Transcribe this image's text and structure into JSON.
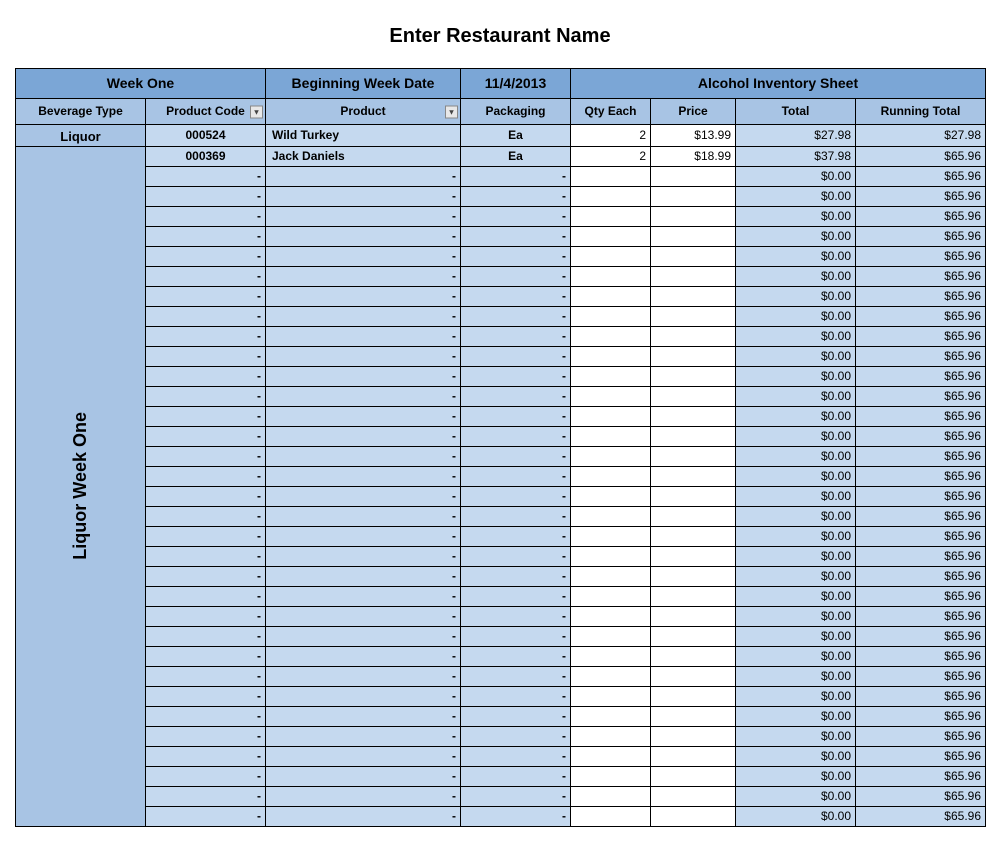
{
  "title": "Enter Restaurant Name",
  "header": {
    "week_label": "Week One",
    "begin_label": "Beginning Week Date",
    "begin_date": "11/4/2013",
    "sheet_label": "Alcohol Inventory Sheet"
  },
  "columns": {
    "bev_type": "Beverage Type",
    "code": "Product Code",
    "product": "Product",
    "packaging": "Packaging",
    "qty": "Qty Each",
    "price": "Price",
    "total": "Total",
    "running": "Running Total"
  },
  "category": "Liquor",
  "side_label": "Liquor Week One",
  "dash": "-",
  "rows": [
    {
      "code": "000524",
      "product": "Wild Turkey",
      "packaging": "Ea",
      "qty": "2",
      "price": "$13.99",
      "total": "$27.98",
      "running": "$27.98"
    },
    {
      "code": "000369",
      "product": "Jack Daniels",
      "packaging": "Ea",
      "qty": "2",
      "price": "$18.99",
      "total": "$37.98",
      "running": "$65.96"
    },
    {
      "code": "-",
      "product": "-",
      "packaging": "-",
      "qty": "",
      "price": "",
      "total": "$0.00",
      "running": "$65.96"
    },
    {
      "code": "-",
      "product": "-",
      "packaging": "-",
      "qty": "",
      "price": "",
      "total": "$0.00",
      "running": "$65.96"
    },
    {
      "code": "-",
      "product": "-",
      "packaging": "-",
      "qty": "",
      "price": "",
      "total": "$0.00",
      "running": "$65.96"
    },
    {
      "code": "-",
      "product": "-",
      "packaging": "-",
      "qty": "",
      "price": "",
      "total": "$0.00",
      "running": "$65.96"
    },
    {
      "code": "-",
      "product": "-",
      "packaging": "-",
      "qty": "",
      "price": "",
      "total": "$0.00",
      "running": "$65.96"
    },
    {
      "code": "-",
      "product": "-",
      "packaging": "-",
      "qty": "",
      "price": "",
      "total": "$0.00",
      "running": "$65.96"
    },
    {
      "code": "-",
      "product": "-",
      "packaging": "-",
      "qty": "",
      "price": "",
      "total": "$0.00",
      "running": "$65.96"
    },
    {
      "code": "-",
      "product": "-",
      "packaging": "-",
      "qty": "",
      "price": "",
      "total": "$0.00",
      "running": "$65.96"
    },
    {
      "code": "-",
      "product": "-",
      "packaging": "-",
      "qty": "",
      "price": "",
      "total": "$0.00",
      "running": "$65.96"
    },
    {
      "code": "-",
      "product": "-",
      "packaging": "-",
      "qty": "",
      "price": "",
      "total": "$0.00",
      "running": "$65.96"
    },
    {
      "code": "-",
      "product": "-",
      "packaging": "-",
      "qty": "",
      "price": "",
      "total": "$0.00",
      "running": "$65.96"
    },
    {
      "code": "-",
      "product": "-",
      "packaging": "-",
      "qty": "",
      "price": "",
      "total": "$0.00",
      "running": "$65.96"
    },
    {
      "code": "-",
      "product": "-",
      "packaging": "-",
      "qty": "",
      "price": "",
      "total": "$0.00",
      "running": "$65.96"
    },
    {
      "code": "-",
      "product": "-",
      "packaging": "-",
      "qty": "",
      "price": "",
      "total": "$0.00",
      "running": "$65.96"
    },
    {
      "code": "-",
      "product": "-",
      "packaging": "-",
      "qty": "",
      "price": "",
      "total": "$0.00",
      "running": "$65.96"
    },
    {
      "code": "-",
      "product": "-",
      "packaging": "-",
      "qty": "",
      "price": "",
      "total": "$0.00",
      "running": "$65.96"
    },
    {
      "code": "-",
      "product": "-",
      "packaging": "-",
      "qty": "",
      "price": "",
      "total": "$0.00",
      "running": "$65.96"
    },
    {
      "code": "-",
      "product": "-",
      "packaging": "-",
      "qty": "",
      "price": "",
      "total": "$0.00",
      "running": "$65.96"
    },
    {
      "code": "-",
      "product": "-",
      "packaging": "-",
      "qty": "",
      "price": "",
      "total": "$0.00",
      "running": "$65.96"
    },
    {
      "code": "-",
      "product": "-",
      "packaging": "-",
      "qty": "",
      "price": "",
      "total": "$0.00",
      "running": "$65.96"
    },
    {
      "code": "-",
      "product": "-",
      "packaging": "-",
      "qty": "",
      "price": "",
      "total": "$0.00",
      "running": "$65.96"
    },
    {
      "code": "-",
      "product": "-",
      "packaging": "-",
      "qty": "",
      "price": "",
      "total": "$0.00",
      "running": "$65.96"
    },
    {
      "code": "-",
      "product": "-",
      "packaging": "-",
      "qty": "",
      "price": "",
      "total": "$0.00",
      "running": "$65.96"
    },
    {
      "code": "-",
      "product": "-",
      "packaging": "-",
      "qty": "",
      "price": "",
      "total": "$0.00",
      "running": "$65.96"
    },
    {
      "code": "-",
      "product": "-",
      "packaging": "-",
      "qty": "",
      "price": "",
      "total": "$0.00",
      "running": "$65.96"
    },
    {
      "code": "-",
      "product": "-",
      "packaging": "-",
      "qty": "",
      "price": "",
      "total": "$0.00",
      "running": "$65.96"
    },
    {
      "code": "-",
      "product": "-",
      "packaging": "-",
      "qty": "",
      "price": "",
      "total": "$0.00",
      "running": "$65.96"
    },
    {
      "code": "-",
      "product": "-",
      "packaging": "-",
      "qty": "",
      "price": "",
      "total": "$0.00",
      "running": "$65.96"
    },
    {
      "code": "-",
      "product": "-",
      "packaging": "-",
      "qty": "",
      "price": "",
      "total": "$0.00",
      "running": "$65.96"
    },
    {
      "code": "-",
      "product": "-",
      "packaging": "-",
      "qty": "",
      "price": "",
      "total": "$0.00",
      "running": "$65.96"
    },
    {
      "code": "-",
      "product": "-",
      "packaging": "-",
      "qty": "",
      "price": "",
      "total": "$0.00",
      "running": "$65.96"
    },
    {
      "code": "-",
      "product": "-",
      "packaging": "-",
      "qty": "",
      "price": "",
      "total": "$0.00",
      "running": "$65.96"
    },
    {
      "code": "-",
      "product": "-",
      "packaging": "-",
      "qty": "",
      "price": "",
      "total": "$0.00",
      "running": "$65.96"
    }
  ]
}
